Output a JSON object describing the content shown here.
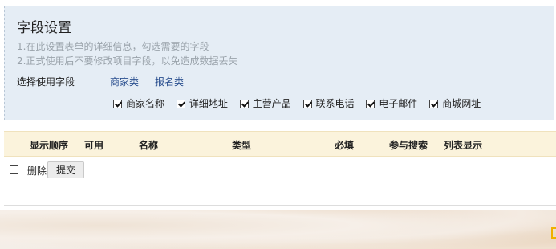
{
  "panel": {
    "title": "字段设置",
    "tips": [
      "1.在此设置表单的详细信息，勾选需要的字段",
      "2.正式使用后不要修改项目字段，以免造成数据丢失"
    ],
    "field_label": "选择使用字段",
    "categories": [
      "商家类",
      "报名类"
    ],
    "fields": [
      {
        "label": "商家名称",
        "checked": true
      },
      {
        "label": "详细地址",
        "checked": true
      },
      {
        "label": "主营产品",
        "checked": true
      },
      {
        "label": "联系电话",
        "checked": true
      },
      {
        "label": "电子邮件",
        "checked": true
      },
      {
        "label": "商城网址",
        "checked": true
      }
    ]
  },
  "table": {
    "headers": [
      "显示顺序",
      "可用",
      "名称",
      "类型",
      "必填",
      "参与搜索",
      "列表显示"
    ]
  },
  "actions": {
    "delete_label": "删除",
    "submit_label": "提交"
  },
  "colors": {
    "panel_bg": "#e5edf5",
    "header_bg": "#fbf3dc",
    "link": "#2a4f8f"
  }
}
